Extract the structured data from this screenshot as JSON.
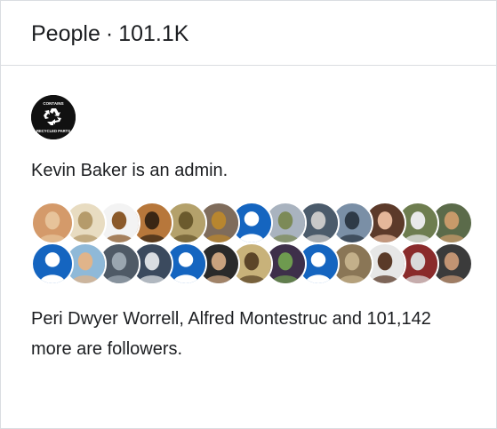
{
  "header": {
    "title": "People",
    "separator": "·",
    "count": "101.1K"
  },
  "admin": {
    "name": "Kevin Baker",
    "suffix": " is an admin.",
    "avatar_text_top": "CONTAINS",
    "avatar_text_bottom": "RECYCLED PARTS",
    "avatar_icon": "recycle-icon"
  },
  "followers": {
    "row1": [
      {
        "label": "Follower 1",
        "color": "#d49a6a",
        "kind": "photo",
        "accent": "#e7c39a"
      },
      {
        "label": "Follower 2",
        "color": "#e8dcc1",
        "kind": "photo",
        "accent": "#b59b6b"
      },
      {
        "label": "Follower 3",
        "color": "#f3f3f3",
        "kind": "photo",
        "accent": "#8b5a2b"
      },
      {
        "label": "Follower 4",
        "color": "#b7773b",
        "kind": "photo",
        "accent": "#3a2614"
      },
      {
        "label": "Follower 5",
        "color": "#b4a16b",
        "kind": "photo",
        "accent": "#6b5a2d"
      },
      {
        "label": "Follower 6",
        "color": "#7f6c5b",
        "kind": "photo",
        "accent": "#b8862f"
      },
      {
        "label": "Follower 7",
        "color": "#1565c0",
        "kind": "default",
        "accent": "#ffffff"
      },
      {
        "label": "Follower 8",
        "color": "#a9b3bf",
        "kind": "photo",
        "accent": "#7c8a57"
      },
      {
        "label": "Follower 9",
        "color": "#4b5b6b",
        "kind": "photo",
        "accent": "#c8c8c8"
      },
      {
        "label": "Follower 10",
        "color": "#7a8fa6",
        "kind": "photo",
        "accent": "#2e3a47"
      },
      {
        "label": "Follower 11",
        "color": "#5c3a2a",
        "kind": "photo",
        "accent": "#e5b79a"
      },
      {
        "label": "Follower 12",
        "color": "#6e7d4f",
        "kind": "photo",
        "accent": "#e9e9e9"
      },
      {
        "label": "Follower 13",
        "color": "#5b6b4a",
        "kind": "photo",
        "accent": "#c79a6a"
      }
    ],
    "row2": [
      {
        "label": "Follower 14",
        "color": "#1565c0",
        "kind": "default",
        "accent": "#ffffff"
      },
      {
        "label": "Follower 15",
        "color": "#8fb9d8",
        "kind": "photo",
        "accent": "#e0b48a"
      },
      {
        "label": "Follower 16",
        "color": "#4f5a66",
        "kind": "photo",
        "accent": "#9aa6b0"
      },
      {
        "label": "Follower 17",
        "color": "#3b4a5e",
        "kind": "photo",
        "accent": "#d9dde2"
      },
      {
        "label": "Follower 18",
        "color": "#1565c0",
        "kind": "default",
        "accent": "#ffffff"
      },
      {
        "label": "Follower 19",
        "color": "#2a2a2a",
        "kind": "photo",
        "accent": "#c9a27e"
      },
      {
        "label": "Follower 20",
        "color": "#c8b27a",
        "kind": "photo",
        "accent": "#5c4528"
      },
      {
        "label": "Follower 21",
        "color": "#3e2f4a",
        "kind": "photo",
        "accent": "#6e9a4f"
      },
      {
        "label": "Follower 22",
        "color": "#1565c0",
        "kind": "default",
        "accent": "#ffffff"
      },
      {
        "label": "Follower 23",
        "color": "#8a7656",
        "kind": "photo",
        "accent": "#c3b08a"
      },
      {
        "label": "Follower 24",
        "color": "#e6e6e6",
        "kind": "photo",
        "accent": "#5a3a28"
      },
      {
        "label": "Follower 25",
        "color": "#8a2b2b",
        "kind": "photo",
        "accent": "#d9d9d9"
      },
      {
        "label": "Follower 26",
        "color": "#3b3b3b",
        "kind": "photo",
        "accent": "#c29473"
      }
    ]
  },
  "followers_summary": {
    "name1": "Peri Dwyer Worrell",
    "sep": ", ",
    "name2": "Alfred Montestruc",
    "rest": " and 101,142 more are followers."
  }
}
